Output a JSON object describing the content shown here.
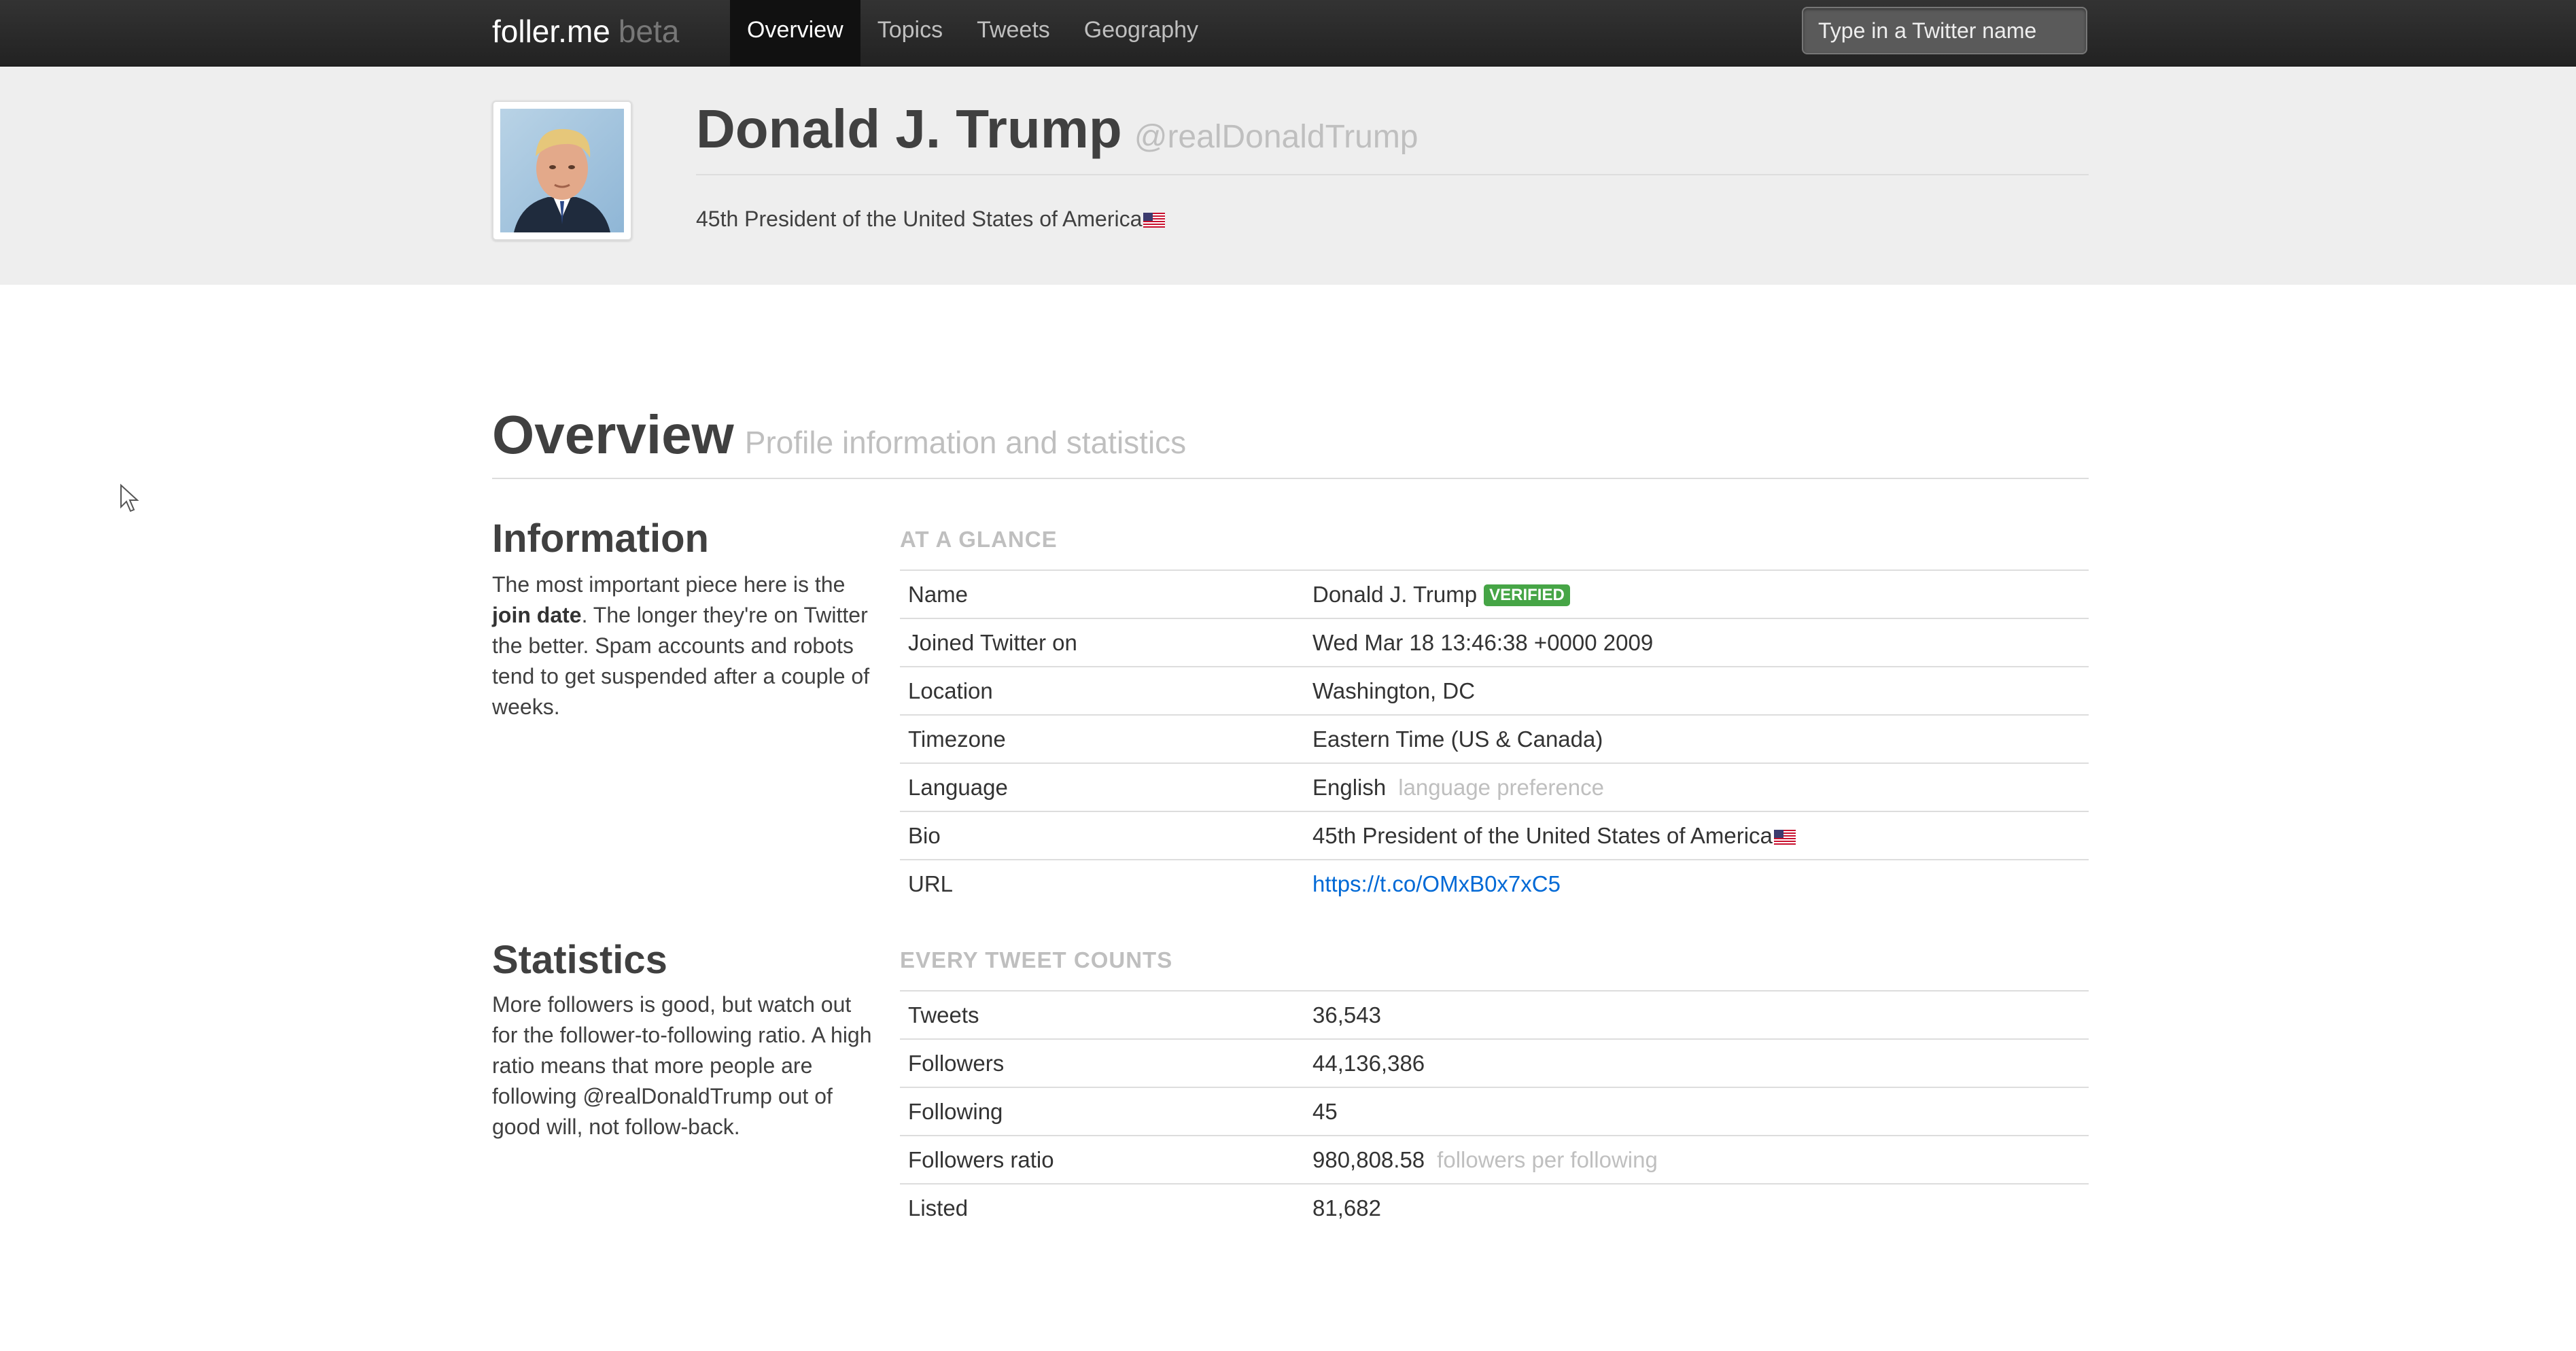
{
  "brand": {
    "name": "foller.me",
    "tag": "beta"
  },
  "nav": [
    {
      "label": "Overview",
      "active": true
    },
    {
      "label": "Topics"
    },
    {
      "label": "Tweets"
    },
    {
      "label": "Geography"
    }
  ],
  "search": {
    "placeholder": "Type in a Twitter name"
  },
  "profile": {
    "name": "Donald J. Trump",
    "handle": "@realDonaldTrump",
    "bio": "45th President of the United States of America"
  },
  "page": {
    "title": "Overview",
    "subtitle": "Profile information and statistics"
  },
  "information": {
    "title": "Information",
    "desc_before": "The most important piece here is the ",
    "desc_bold": "join date",
    "desc_after": ". The longer they're on Twitter the better. Spam accounts and robots tend to get suspended after a couple of weeks.",
    "caption": "AT A GLANCE",
    "rows": {
      "name": {
        "key": "Name",
        "value": "Donald J. Trump",
        "badge": "VERIFIED"
      },
      "joined": {
        "key": "Joined Twitter on",
        "value": "Wed Mar 18 13:46:38 +0000 2009"
      },
      "location": {
        "key": "Location",
        "value": "Washington, DC"
      },
      "timezone": {
        "key": "Timezone",
        "value": "Eastern Time (US & Canada)"
      },
      "language": {
        "key": "Language",
        "value": "English",
        "note": "language preference"
      },
      "bio": {
        "key": "Bio",
        "value": "45th President of the United States of America"
      },
      "url": {
        "key": "URL",
        "value": "https://t.co/OMxB0x7xC5"
      }
    }
  },
  "statistics": {
    "title": "Statistics",
    "desc": "More followers is good, but watch out for the follower-to-following ratio. A high ratio means that more people are following @realDonaldTrump out of good will, not follow-back.",
    "caption": "EVERY TWEET COUNTS",
    "rows": {
      "tweets": {
        "key": "Tweets",
        "value": "36,543"
      },
      "followers": {
        "key": "Followers",
        "value": "44,136,386"
      },
      "following": {
        "key": "Following",
        "value": "45"
      },
      "ratio": {
        "key": "Followers ratio",
        "value": "980,808.58",
        "note": "followers per following"
      },
      "listed": {
        "key": "Listed",
        "value": "81,682"
      }
    }
  },
  "colors": {
    "verified": "#46a546",
    "link": "#0069d6",
    "topbar": "#2b2b2b"
  },
  "icons": {
    "flag": "us-flag-icon",
    "avatar": "profile-photo",
    "cursor": "mouse-pointer-icon"
  }
}
